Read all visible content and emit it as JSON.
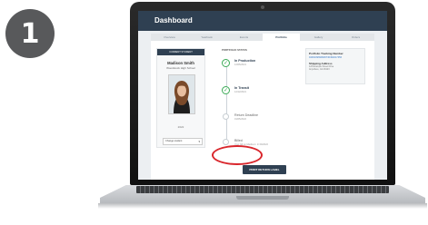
{
  "step_number": "1",
  "app": {
    "title": "Dashboard"
  },
  "tabs": [
    "Overview",
    "Yearbook",
    "Events",
    "Portfolio",
    "Gallery",
    "Orders"
  ],
  "active_tab": "Portfolio",
  "student_card": {
    "header": "CURRENT STUDENT",
    "name": "Madison Smith",
    "school": "Woodstock High School",
    "year": "2022",
    "change_student": "Change student"
  },
  "portfolio_status": {
    "heading": "PORTFOLIO STATUS",
    "steps": [
      {
        "label": "In Production",
        "date": "12/05/2021",
        "done": true
      },
      {
        "label": "In Transit",
        "date": "12/12/2021",
        "done": true
      },
      {
        "label": "Return Deadline",
        "date": "01/05/2022",
        "done": false
      },
      {
        "label": "Billed",
        "date": "Your bill on Madison: 1/ 09/2022",
        "done": false
      }
    ]
  },
  "tracking": {
    "label": "Portfolio Tracking Number",
    "number": "9400109699939730494017456",
    "address_label": "Shipping Address",
    "address_line1": "123 Example Street Drive",
    "address_line2": "Anywhere, GA 30123"
  },
  "actions": {
    "print_return_label": "PRINT RETURN LABEL"
  },
  "colors": {
    "header_bg": "#2f4052",
    "check_green": "#3aaa55",
    "highlight_red": "#d9262c",
    "badge_gray": "#58595b"
  }
}
